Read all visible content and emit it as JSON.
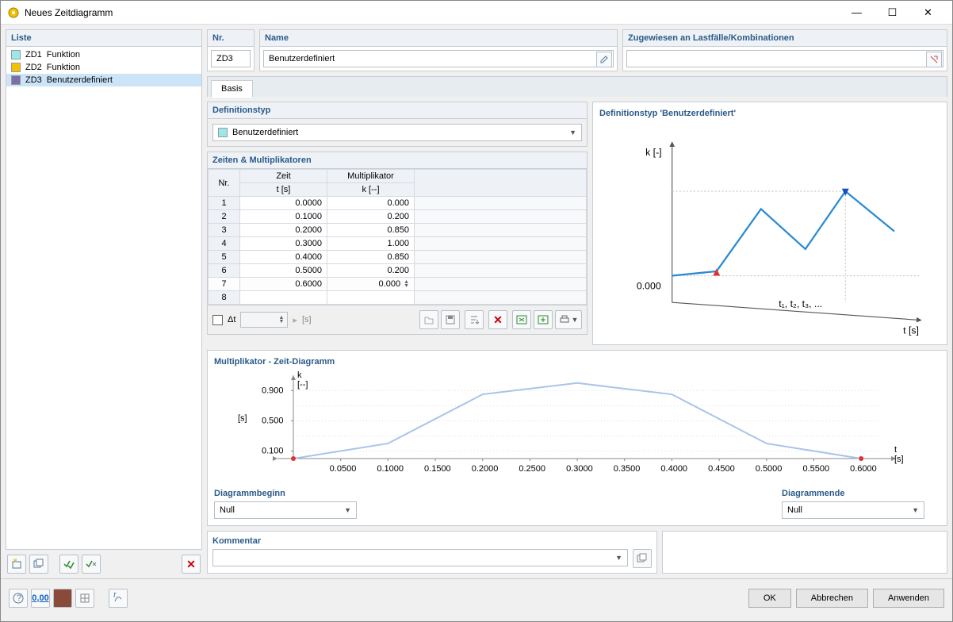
{
  "window": {
    "title": "Neues Zeitdiagramm"
  },
  "list": {
    "header": "Liste",
    "items": [
      {
        "id": "ZD1",
        "label": "Funktion",
        "color": "#9be8e8"
      },
      {
        "id": "ZD2",
        "label": "Funktion",
        "color": "#f2c200"
      },
      {
        "id": "ZD3",
        "label": "Benutzerdefiniert",
        "color": "#7a6fa8",
        "selected": true
      }
    ]
  },
  "nr": {
    "header": "Nr.",
    "value": "ZD3"
  },
  "name": {
    "header": "Name",
    "value": "Benutzerdefiniert"
  },
  "assigned": {
    "header": "Zugewiesen an Lastfälle/Kombinationen",
    "value": ""
  },
  "tab": {
    "basis": "Basis"
  },
  "deftype": {
    "header": "Definitionstyp",
    "value": "Benutzerdefiniert"
  },
  "table": {
    "header": "Zeiten & Multiplikatoren",
    "col_nr": "Nr.",
    "col_t": "Zeit",
    "col_t_unit": "t [s]",
    "col_k": "Multiplikator",
    "col_k_unit": "k [--]",
    "rows": [
      {
        "n": "1",
        "t": "0.0000",
        "k": "0.000"
      },
      {
        "n": "2",
        "t": "0.1000",
        "k": "0.200"
      },
      {
        "n": "3",
        "t": "0.2000",
        "k": "0.850"
      },
      {
        "n": "4",
        "t": "0.3000",
        "k": "1.000"
      },
      {
        "n": "5",
        "t": "0.4000",
        "k": "0.850"
      },
      {
        "n": "6",
        "t": "0.5000",
        "k": "0.200"
      },
      {
        "n": "7",
        "t": "0.6000",
        "k": "0.000"
      },
      {
        "n": "8",
        "t": "",
        "k": ""
      }
    ],
    "delta_label": "Δt",
    "delta_unit": "[s]"
  },
  "preview": {
    "title": "Definitionstyp 'Benutzerdefiniert'",
    "ylabel": "k [-]",
    "xlabel": "t [s]",
    "zero": "0.000",
    "ticks": "t₁, t₂, t₃, ..."
  },
  "chart": {
    "title": "Multiplikator - Zeit-Diagramm",
    "ylabel": "k",
    "yunit": "[--]",
    "xlabel": "t",
    "xunit": "[s]",
    "side_unit": "[s]",
    "yticks": [
      "0.100",
      "0.500",
      "0.900"
    ],
    "xticks": [
      "0.0500",
      "0.1000",
      "0.1500",
      "0.2000",
      "0.2500",
      "0.3000",
      "0.3500",
      "0.4000",
      "0.4500",
      "0.5000",
      "0.5500",
      "0.6000"
    ]
  },
  "chart_data": {
    "type": "line",
    "x": [
      0.0,
      0.1,
      0.2,
      0.3,
      0.4,
      0.5,
      0.6
    ],
    "y": [
      0.0,
      0.2,
      0.85,
      1.0,
      0.85,
      0.2,
      0.0
    ],
    "xlabel": "t [s]",
    "ylabel": "k [--]",
    "xlim": [
      0,
      0.65
    ],
    "ylim": [
      0,
      1.0
    ],
    "title": "Multiplikator - Zeit-Diagramm"
  },
  "diag": {
    "begin_label": "Diagrammbeginn",
    "end_label": "Diagrammende",
    "begin_value": "Null",
    "end_value": "Null"
  },
  "comment": {
    "label": "Kommentar",
    "value": ""
  },
  "footer": {
    "ok": "OK",
    "cancel": "Abbrechen",
    "apply": "Anwenden"
  }
}
